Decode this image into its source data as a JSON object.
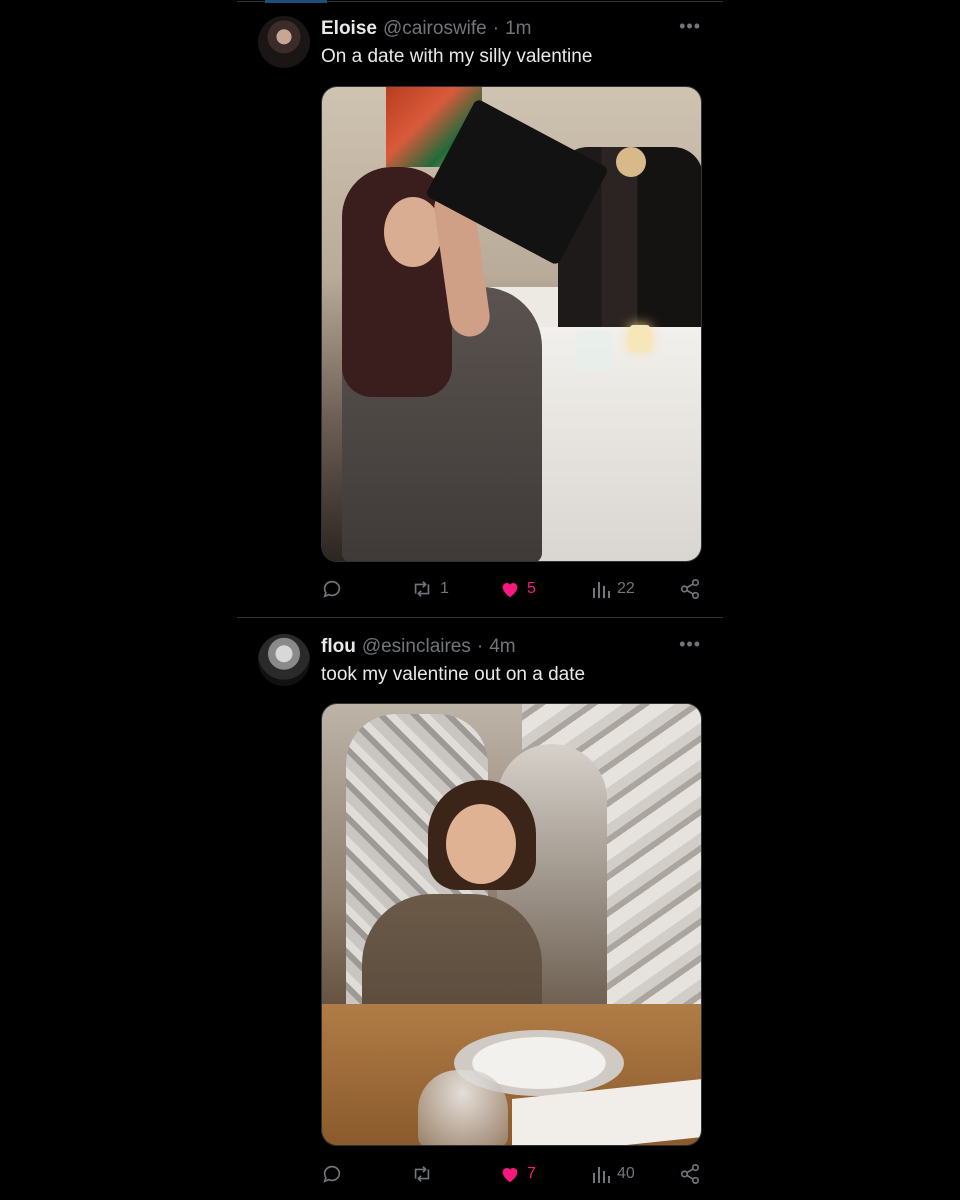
{
  "tweets": [
    {
      "name": "Eloise",
      "handle": "@cairoswife",
      "dot": "·",
      "time": "1m",
      "text": "On a date with my silly valentine",
      "reposts": "1",
      "likes": "5",
      "views": "22"
    },
    {
      "name": "flou",
      "handle": "@esinclaires",
      "dot": "·",
      "time": "4m",
      "text": "took my valentine out on a date",
      "reposts": "",
      "likes": "7",
      "views": "40"
    }
  ],
  "more_label": "•••",
  "colors": {
    "background": "#000000",
    "text": "#e7e9ea",
    "muted": "#71767b",
    "like": "#f91880",
    "divider": "#2f3336"
  },
  "icons": [
    "reply-icon",
    "repost-icon",
    "heart-icon",
    "views-icon",
    "share-icon",
    "more-icon"
  ]
}
